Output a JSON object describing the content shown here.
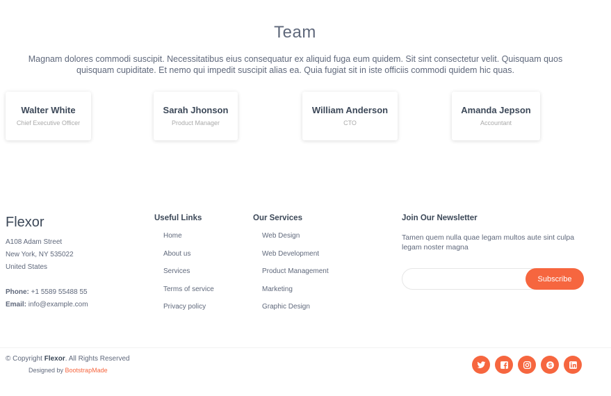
{
  "team": {
    "title": "Team",
    "description": "Magnam dolores commodi suscipit. Necessitatibus eius consequatur ex aliquid fuga eum quidem. Sit sint consectetur velit. Quisquam quos quisquam cupiditate. Et nemo qui impedit suscipit alias ea. Quia fugiat sit in iste officiis commodi quidem hic quas.",
    "members": [
      {
        "name": "Walter White",
        "role": "Chief Executive Officer"
      },
      {
        "name": "Sarah Jhonson",
        "role": "Product Manager"
      },
      {
        "name": "William Anderson",
        "role": "CTO"
      },
      {
        "name": "Amanda Jepson",
        "role": "Accountant"
      }
    ]
  },
  "footer": {
    "brand": "Flexor",
    "address": [
      "A108 Adam Street",
      "New York, NY 535022",
      "United States"
    ],
    "phone_label": "Phone:",
    "phone": "+1 5589 55488 55",
    "email_label": "Email:",
    "email": "info@example.com",
    "useful_links": {
      "title": "Useful Links",
      "items": [
        "Home",
        "About us",
        "Services",
        "Terms of service",
        "Privacy policy"
      ]
    },
    "services": {
      "title": "Our Services",
      "items": [
        "Web Design",
        "Web Development",
        "Product Management",
        "Marketing",
        "Graphic Design"
      ]
    },
    "newsletter": {
      "title": "Join Our Newsletter",
      "text": "Tamen quem nulla quae legam multos aute sint culpa legam noster magna",
      "input_value": "",
      "button": "Subscribe"
    }
  },
  "bottom": {
    "copyright_prefix": "© Copyright ",
    "brand": "Flexor",
    "copyright_suffix": ". All Rights Reserved",
    "designed_by": "Designed by ",
    "designer": "BootstrapMade",
    "social": [
      "twitter-icon",
      "facebook-icon",
      "instagram-icon",
      "skype-icon",
      "linkedin-icon"
    ]
  },
  "colors": {
    "accent": "#f6663f",
    "heading": "#3c4858",
    "text": "#5f687b"
  }
}
